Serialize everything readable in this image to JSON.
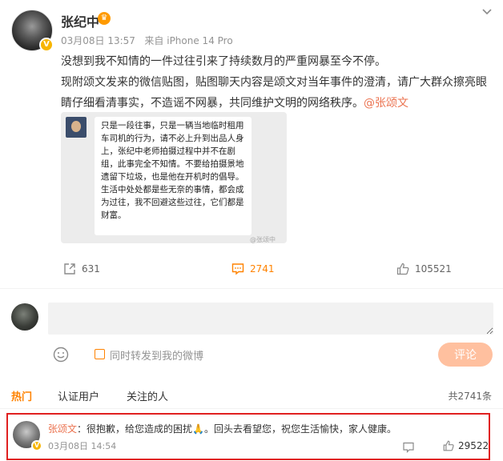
{
  "post": {
    "author": "张纪中",
    "vip_badge": "♛",
    "date": "03月08日 13:57",
    "source": "来自 iPhone 14 Pro",
    "paragraph1": "没想到我不知情的一件过往引来了持续数月的严重网暴至今不停。",
    "paragraph2": "现附颂文发来的微信贴图，贴图聊天内容是颂文对当年事件的澄清，请广大群众擦亮眼睛仔细看清事实，不造谣不网暴，共同维护文明的网络秩序。",
    "mention": "@张颂文",
    "image": {
      "bubble_text": "只是一段往事，只是一辆当地临时租用车司机的行为，请不必上升到出品人身上，张纪中老师拍摄过程中并不在剧组，此事完全不知情。不要给拍摄景地遗留下垃圾，也是他在开机时的倡导。生活中处处都是些无奈的事情，都会成为过往，我不回避这些过往，它们都是财富。",
      "watermark": "@张颂中"
    }
  },
  "actions": {
    "share_count": "631",
    "comment_count": "2741",
    "like_count": "105521"
  },
  "composer": {
    "repost_label": "同时转发到我的微博",
    "submit_label": "评论"
  },
  "tabs": {
    "hot": "热门",
    "verified": "认证用户",
    "following": "关注的人",
    "total": "共2741条"
  },
  "top_comment": {
    "user": "张颂文",
    "separator": "：",
    "text": "很抱歉，给您造成的困扰🙏。回头去看望您，祝您生活愉快，家人健康。",
    "time": "03月08日 14:54",
    "likes": "29522"
  },
  "colors": {
    "accent": "#ff8200",
    "mention": "#eb7350",
    "highlight": "#e02020",
    "submit_bg": "#ffc09f"
  }
}
